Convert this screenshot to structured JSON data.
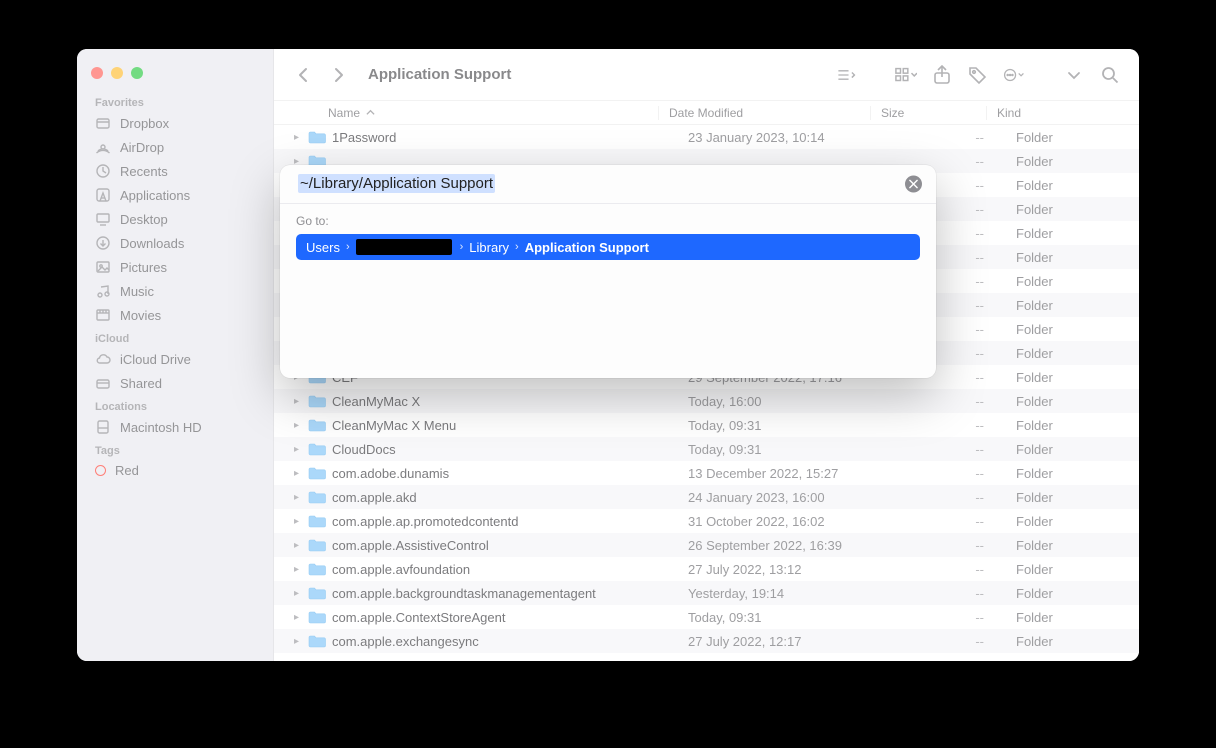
{
  "window": {
    "title": "Application Support"
  },
  "sidebar": {
    "sections": [
      {
        "heading": "Favorites",
        "items": [
          {
            "label": "Dropbox",
            "icon": "box-icon"
          },
          {
            "label": "AirDrop",
            "icon": "airdrop-icon"
          },
          {
            "label": "Recents",
            "icon": "clock-icon"
          },
          {
            "label": "Applications",
            "icon": "apps-icon"
          },
          {
            "label": "Desktop",
            "icon": "desktop-icon"
          },
          {
            "label": "Downloads",
            "icon": "download-icon"
          },
          {
            "label": "Pictures",
            "icon": "pictures-icon"
          },
          {
            "label": "Music",
            "icon": "music-icon"
          },
          {
            "label": "Movies",
            "icon": "movies-icon"
          }
        ]
      },
      {
        "heading": "iCloud",
        "items": [
          {
            "label": "iCloud Drive",
            "icon": "cloud-icon"
          },
          {
            "label": "Shared",
            "icon": "shared-icon"
          }
        ]
      },
      {
        "heading": "Locations",
        "items": [
          {
            "label": "Macintosh HD",
            "icon": "disk-icon"
          }
        ]
      },
      {
        "heading": "Tags",
        "items": [
          {
            "label": "Red",
            "icon": "tag-red"
          }
        ]
      }
    ]
  },
  "columns": {
    "name": "Name",
    "date": "Date Modified",
    "size": "Size",
    "kind": "Kind"
  },
  "rows": [
    {
      "name": "1Password",
      "date": "23 January 2023, 10:14",
      "size": "--",
      "kind": "Folder"
    },
    {
      "name": "",
      "date": "",
      "size": "--",
      "kind": "Folder"
    },
    {
      "name": "",
      "date": "",
      "size": "--",
      "kind": "Folder"
    },
    {
      "name": "",
      "date": "",
      "size": "--",
      "kind": "Folder"
    },
    {
      "name": "",
      "date": "",
      "size": "--",
      "kind": "Folder"
    },
    {
      "name": "",
      "date": "",
      "size": "--",
      "kind": "Folder"
    },
    {
      "name": "",
      "date": "",
      "size": "--",
      "kind": "Folder"
    },
    {
      "name": "",
      "date": "",
      "size": "--",
      "kind": "Folder"
    },
    {
      "name": "",
      "date": "",
      "size": "--",
      "kind": "Folder"
    },
    {
      "name": "",
      "date": "",
      "size": "--",
      "kind": "Folder"
    },
    {
      "name": "CEF",
      "date": "29 September 2022, 17:16",
      "size": "--",
      "kind": "Folder"
    },
    {
      "name": "CleanMyMac X",
      "date": "Today, 16:00",
      "size": "--",
      "kind": "Folder"
    },
    {
      "name": "CleanMyMac X Menu",
      "date": "Today, 09:31",
      "size": "--",
      "kind": "Folder"
    },
    {
      "name": "CloudDocs",
      "date": "Today, 09:31",
      "size": "--",
      "kind": "Folder"
    },
    {
      "name": "com.adobe.dunamis",
      "date": "13 December 2022, 15:27",
      "size": "--",
      "kind": "Folder"
    },
    {
      "name": "com.apple.akd",
      "date": "24 January 2023, 16:00",
      "size": "--",
      "kind": "Folder"
    },
    {
      "name": "com.apple.ap.promotedcontentd",
      "date": "31 October 2022, 16:02",
      "size": "--",
      "kind": "Folder"
    },
    {
      "name": "com.apple.AssistiveControl",
      "date": "26 September 2022, 16:39",
      "size": "--",
      "kind": "Folder"
    },
    {
      "name": "com.apple.avfoundation",
      "date": "27 July 2022, 13:12",
      "size": "--",
      "kind": "Folder"
    },
    {
      "name": "com.apple.backgroundtaskmanagementagent",
      "date": "Yesterday, 19:14",
      "size": "--",
      "kind": "Folder"
    },
    {
      "name": "com.apple.ContextStoreAgent",
      "date": "Today, 09:31",
      "size": "--",
      "kind": "Folder"
    },
    {
      "name": "com.apple.exchangesync",
      "date": "27 July 2022, 12:17",
      "size": "--",
      "kind": "Folder"
    }
  ],
  "dialog": {
    "input_text": "~/Library/Application Support",
    "goto_label": "Go to:",
    "breadcrumb": {
      "seg1": "Users",
      "seg2_redacted": true,
      "seg3": "Library",
      "seg4": "Application Support"
    }
  }
}
